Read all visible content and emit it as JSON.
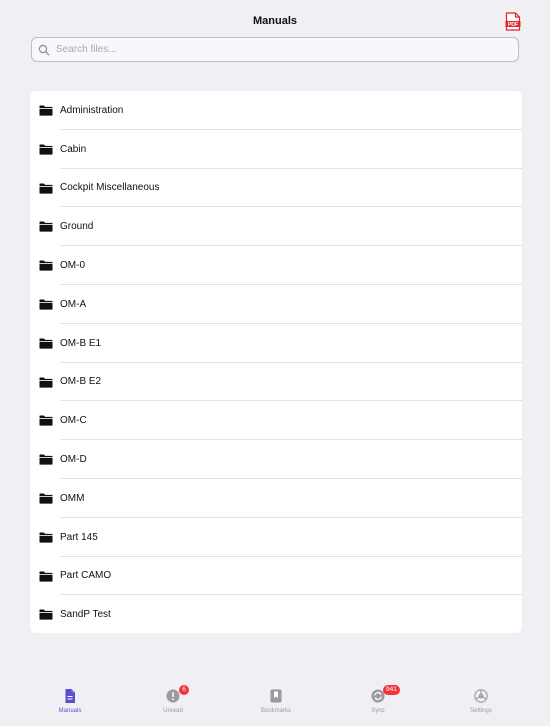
{
  "header": {
    "title": "Manuals",
    "pdf_icon_label": "PDF"
  },
  "search": {
    "placeholder": "Search files...",
    "value": ""
  },
  "folders": [
    {
      "label": "Administration"
    },
    {
      "label": "Cabin"
    },
    {
      "label": "Cockpit Miscellaneous"
    },
    {
      "label": "Ground"
    },
    {
      "label": "OM-0"
    },
    {
      "label": "OM-A"
    },
    {
      "label": "OM-B E1"
    },
    {
      "label": "OM-B E2"
    },
    {
      "label": "OM-C"
    },
    {
      "label": "OM-D"
    },
    {
      "label": "OMM"
    },
    {
      "label": "Part 145"
    },
    {
      "label": "Part CAMO"
    },
    {
      "label": "SandP Test"
    }
  ],
  "tabbar": {
    "tabs": [
      {
        "label": "Manuals",
        "icon": "document-icon",
        "active": true
      },
      {
        "label": "Unread",
        "icon": "exclamation-icon",
        "badge": "6"
      },
      {
        "label": "Bookmarks",
        "icon": "bookmark-icon"
      },
      {
        "label": "Sync",
        "icon": "sync-icon",
        "badge": "941"
      },
      {
        "label": "Settings",
        "icon": "gear-icon"
      }
    ]
  },
  "colors": {
    "accent": "#5a4fcf",
    "badge": "#f0353b",
    "background": "#efeff4",
    "pdf_red": "#e0232b"
  }
}
